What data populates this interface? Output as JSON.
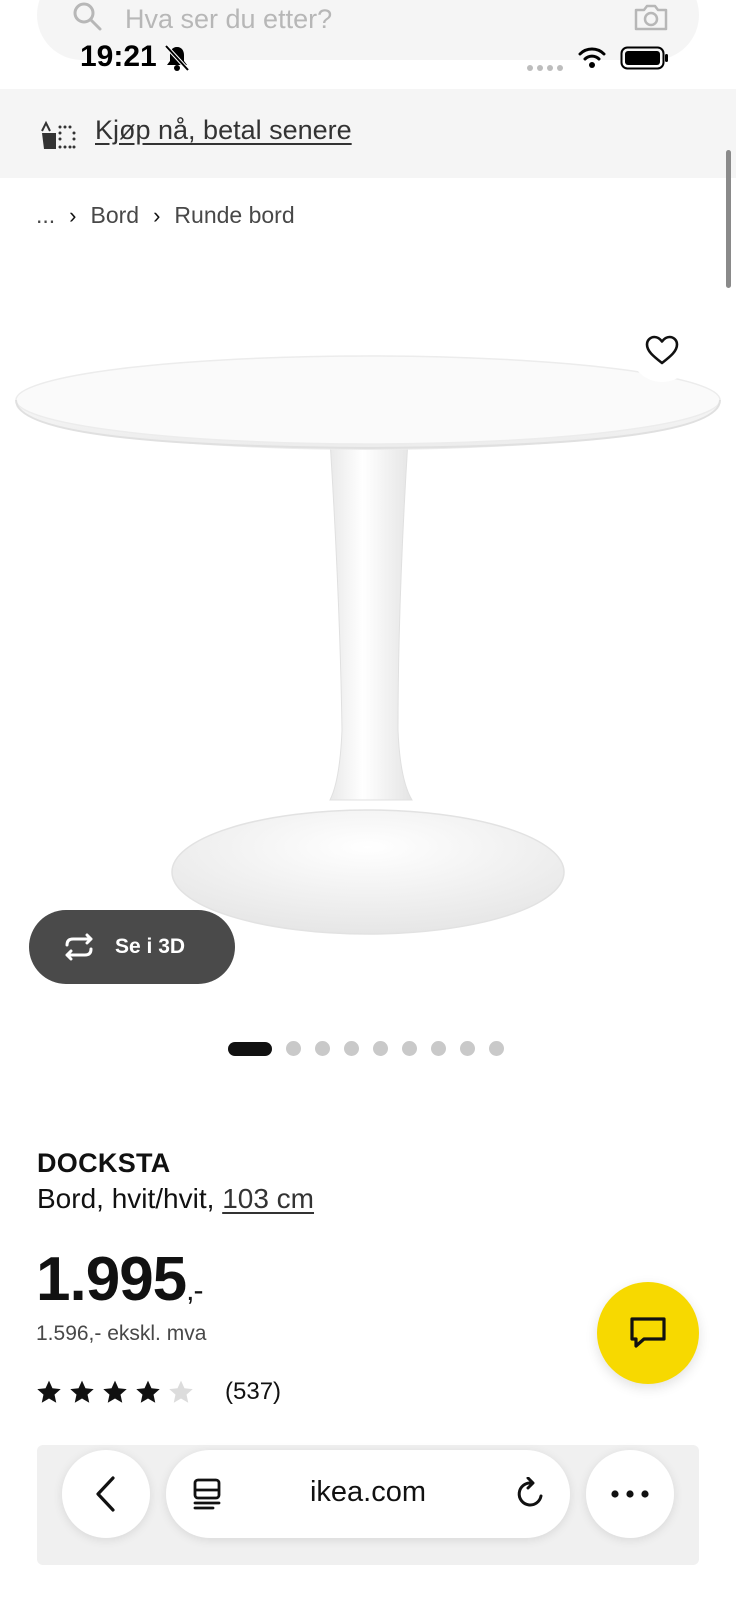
{
  "search": {
    "placeholder": "Hva ser du etter?"
  },
  "status_bar": {
    "time": "19:21"
  },
  "banner": {
    "link_text": "Kjøp nå, betal senere"
  },
  "breadcrumb": {
    "ellipsis": "...",
    "items": [
      "Bord",
      "Runde bord"
    ]
  },
  "gallery": {
    "view_3d_label": "Se i 3D",
    "total_images": 9,
    "active_index": 0
  },
  "product": {
    "name": "DOCKSTA",
    "description_prefix": "Bord, hvit/hvit,",
    "size_link": "103 cm",
    "price_main": "1.995",
    "price_suffix": ",-",
    "price_excl_vat": "1.596,- ekskl. mva",
    "rating": 4,
    "rating_count": "(537)"
  },
  "browser": {
    "url": "ikea.com"
  },
  "colors": {
    "chat_button": "#f7d900",
    "banner_bg": "#f5f5f5",
    "btn_3d_bg": "#4a4a4a"
  }
}
